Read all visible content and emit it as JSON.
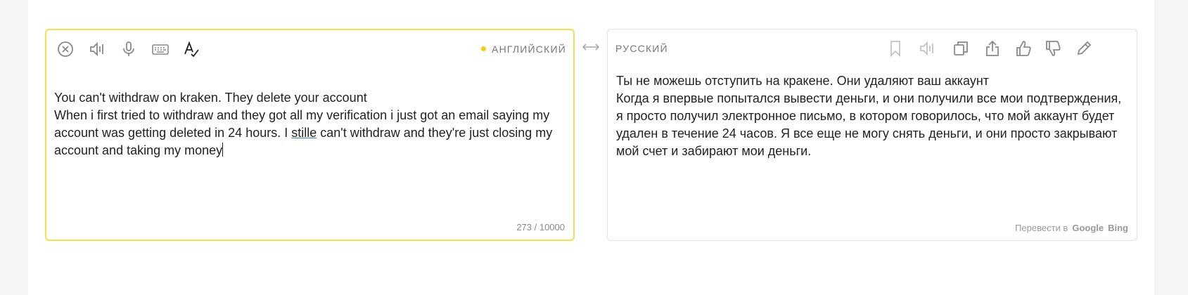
{
  "source_panel": {
    "language_label": "АНГЛИЙСКИЙ",
    "text_line1": "You can't withdraw on kraken. They delete your account",
    "text_line2a": "When i first tried to withdraw and they got all my verification i just got an email saying my account was getting deleted in 24 hours. I ",
    "text_misspelled": "stille",
    "text_line2b": " can't withdraw and they're just closing my account and taking my money",
    "char_counter": "273 / 10000",
    "icons": [
      "clear-icon",
      "listen-icon",
      "microphone-icon",
      "keyboard-icon",
      "spellcheck-icon"
    ]
  },
  "target_panel": {
    "language_label": "РУССКИЙ",
    "text": "Ты не можешь отступить на кракене. Они удаляют ваш аккаунт\nКогда я впервые попытался вывести деньги, и они получили все мои подтверждения, я просто получил электронное письмо, в котором говорилось, что мой аккаунт будет удален в течение 24 часов. Я все еще не могу снять деньги, и они просто закрывают мой счет и забирают мои деньги.",
    "translate_in_label": "Перевести в",
    "engine_google": "Google",
    "engine_bing": "Bing",
    "icons": [
      "bookmark-icon",
      "listen-icon",
      "copy-icon",
      "share-icon",
      "thumbs-up-icon",
      "thumbs-down-icon",
      "edit-icon"
    ]
  },
  "colors": {
    "accent_yellow": "#ffdb4d",
    "icon_gray": "#999999",
    "spell_underline": "#4a7bd0"
  }
}
